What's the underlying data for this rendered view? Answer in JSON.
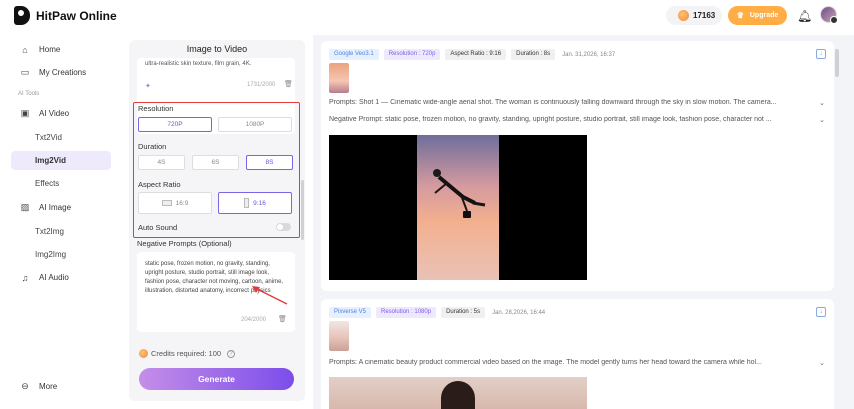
{
  "app": {
    "title": "HitPaw Online"
  },
  "topbar": {
    "credits": "17163",
    "upgrade_label": "Upgrade"
  },
  "sidebar": {
    "home": "Home",
    "my_creations": "My Creations",
    "section": "AI Tools",
    "ai_video": "AI Video",
    "txt2vid": "Txt2Vid",
    "img2vid": "Img2Vid",
    "effects": "Effects",
    "ai_image": "AI Image",
    "txt2img": "Txt2Img",
    "img2img": "Img2Img",
    "ai_audio": "AI Audio",
    "more": "More"
  },
  "panel": {
    "title": "Image to Video",
    "prompt_text": "ultra-realistic skin texture, film grain, 4K.",
    "prompt_count": "1731/2000",
    "resolution_label": "Resolution",
    "resolution_options": [
      "720P",
      "1080P"
    ],
    "resolution_selected": "720P",
    "duration_label": "Duration",
    "duration_options": [
      "4S",
      "6S",
      "8S"
    ],
    "duration_selected": "8S",
    "aspect_label": "Aspect Ratio",
    "aspect_options": [
      "16:9",
      "9:16"
    ],
    "aspect_selected": "9:16",
    "auto_sound_label": "Auto Sound",
    "auto_sound_on": false,
    "negative_label": "Negative Prompts (Optional)",
    "negative_text": "static pose, frozen motion, no gravity, standing, upright posture, studio portrait, still image look, fashion pose, character not moving, cartoon, anime, illustration, distorted anatomy, incorrect physics",
    "negative_count": "204/2000",
    "credits_required": "Credits required: 100",
    "generate_label": "Generate"
  },
  "results": [
    {
      "model": "Google Veo3.1",
      "resolution": "Resolution : 720p",
      "aspect": "Aspect Ratio : 9:16",
      "duration": "Duration : 8s",
      "datetime": "Jan. 31,2026, 16:37",
      "prompt": "Prompts: Shot 1 — Cinematic wide-angle aerial shot. The woman is continuously falling downward through the sky in slow motion. The camera...",
      "negative": "Negative Prompt: static pose, frozen motion, no gravity, standing, upright posture, studio portrait, still image look, fashion pose, character not ..."
    },
    {
      "model": "Pixverse V5",
      "resolution": "Resolution : 1080p",
      "duration": "Duration : 5s",
      "datetime": "Jan. 28,2026, 16:44",
      "prompt": "Prompts: A cinematic beauty product commercial video based on the image. The model gently turns her head toward the camera while hol..."
    }
  ],
  "colors": {
    "accent": "#7b5ee4",
    "upgrade": "#ffae45",
    "highlight_box": "#e13b3b"
  }
}
